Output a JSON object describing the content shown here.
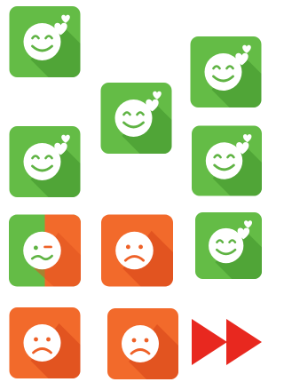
{
  "colors": {
    "happy_bg": "#64bc46",
    "happy_shadow": "#4ea235",
    "sad_bg": "#f26a2b",
    "sad_shadow": "#e0521f",
    "face_fill": "#ffffff",
    "happy_stroke": "#5fb343",
    "sad_stroke": "#ee6128",
    "arrow": "#e8281f"
  },
  "tiles": [
    {
      "id": "tile-1",
      "mood": "happy-heart",
      "icon": "smiley-heart-icon"
    },
    {
      "id": "tile-2",
      "mood": "happy-heart",
      "icon": "smiley-heart-icon"
    },
    {
      "id": "tile-3",
      "mood": "happy-heart",
      "icon": "smiley-heart-icon"
    },
    {
      "id": "tile-4",
      "mood": "happy-heart",
      "icon": "smiley-heart-icon"
    },
    {
      "id": "tile-5",
      "mood": "happy-heart",
      "icon": "smiley-heart-icon"
    },
    {
      "id": "tile-6",
      "mood": "confused",
      "icon": "confused-face-icon"
    },
    {
      "id": "tile-7",
      "mood": "sad",
      "icon": "sad-face-icon"
    },
    {
      "id": "tile-8",
      "mood": "happy-heart",
      "icon": "smiley-heart-icon"
    },
    {
      "id": "tile-9",
      "mood": "sad",
      "icon": "sad-face-icon"
    },
    {
      "id": "tile-10",
      "mood": "sad",
      "icon": "sad-face-icon"
    }
  ],
  "controls": {
    "fast_forward_icon": "fast-forward-icon"
  }
}
